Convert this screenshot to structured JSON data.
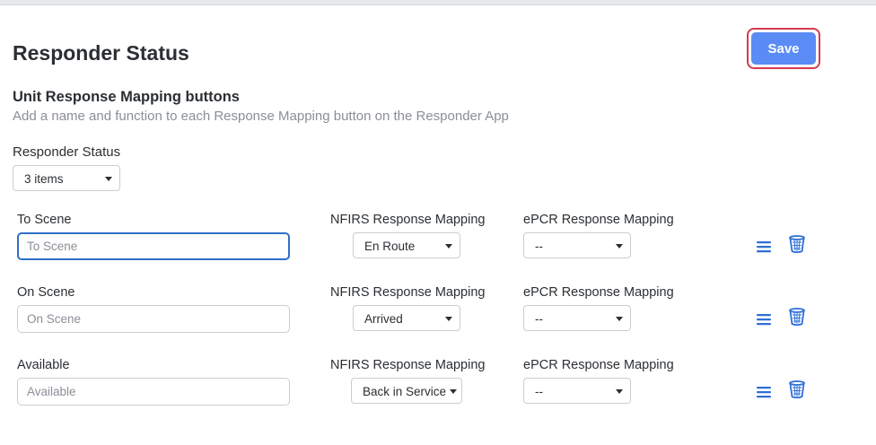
{
  "header": {
    "title": "Responder Status",
    "save_label": "Save"
  },
  "section": {
    "title": "Unit Response Mapping buttons",
    "subtitle": "Add a name and function to each Response Mapping button on the Responder App"
  },
  "status_select": {
    "label": "Responder Status",
    "value": "3 items"
  },
  "rows": [
    {
      "label": "To Scene",
      "placeholder": "To Scene",
      "nfirs_label": "NFIRS Response Mapping",
      "nfirs_value": "En Route",
      "epcr_label": "ePCR Response Mapping",
      "epcr_value": "--"
    },
    {
      "label": "On Scene",
      "placeholder": "On Scene",
      "nfirs_label": "NFIRS Response Mapping",
      "nfirs_value": "Arrived",
      "epcr_label": "ePCR Response Mapping",
      "epcr_value": "--"
    },
    {
      "label": "Available",
      "placeholder": "Available",
      "nfirs_label": "NFIRS Response Mapping",
      "nfirs_value": "Back in Service",
      "epcr_label": "ePCR Response Mapping",
      "epcr_value": "--"
    }
  ],
  "icons": {
    "reorder": "drag-handle-icon",
    "delete": "trash-icon"
  },
  "colors": {
    "accent": "#5b8cf5",
    "icon_blue": "#2f6fd6",
    "focus_border": "#2f6fc7",
    "save_outline": "#d63a52"
  }
}
